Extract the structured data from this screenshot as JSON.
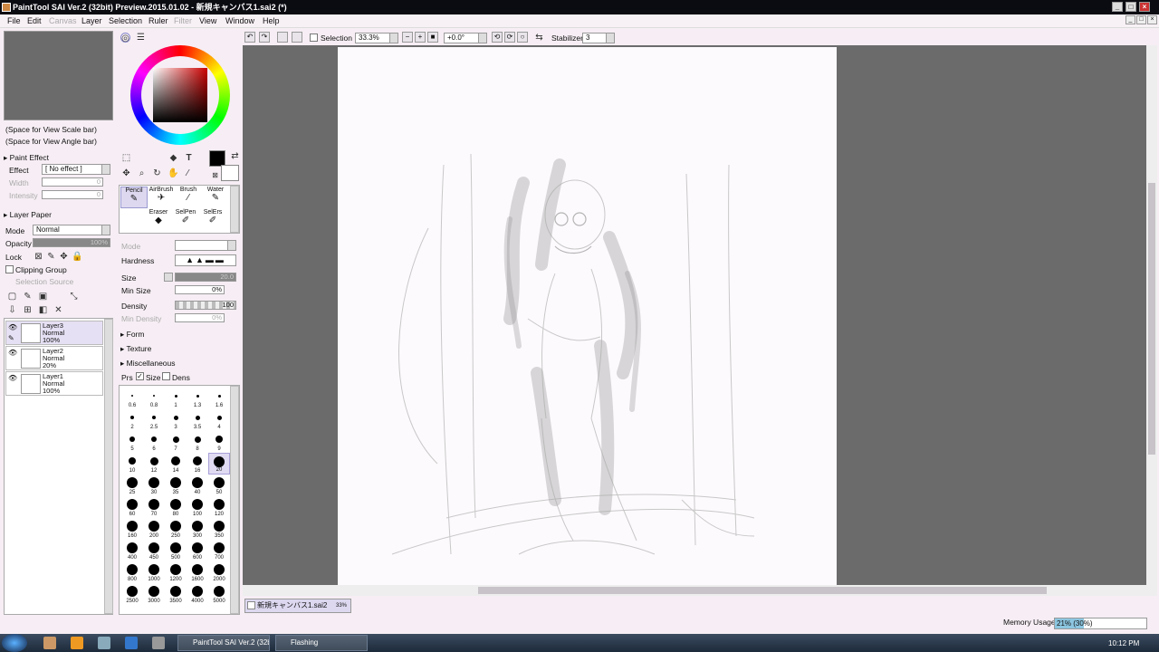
{
  "window": {
    "title": "PaintTool SAI Ver.2 (32bit) Preview.2015.01.02 - 新規キャンバス1.sai2 (*)"
  },
  "menu": [
    {
      "label": "File",
      "enabled": true
    },
    {
      "label": "Edit",
      "enabled": true
    },
    {
      "label": "Canvas",
      "enabled": false
    },
    {
      "label": "Layer",
      "enabled": true
    },
    {
      "label": "Selection",
      "enabled": true
    },
    {
      "label": "Ruler",
      "enabled": true
    },
    {
      "label": "Filter",
      "enabled": false
    },
    {
      "label": "View",
      "enabled": true
    },
    {
      "label": "Window",
      "enabled": true
    },
    {
      "label": "Help",
      "enabled": true
    }
  ],
  "toolbar": {
    "selection_label": "Selection",
    "zoom": "33.3%",
    "angle": "+0.0°",
    "stabilizer_label": "Stabilizer",
    "stabilizer_value": "3"
  },
  "left": {
    "view_scale": "(Space for View Scale bar)",
    "view_angle": "(Space for View Angle bar)",
    "paint_effect_label": "Paint Effect",
    "effect_label": "Effect",
    "effect_value": "[ No effect ]",
    "width_label": "Width",
    "width_value": "0",
    "intensity_label": "Intensity",
    "intensity_value": "0",
    "layer_paper_label": "Layer Paper",
    "mode_label": "Mode",
    "mode_value": "Normal",
    "opacity_label": "Opacity",
    "opacity_value": "100%",
    "lock_label": "Lock",
    "clipping_label": "Clipping Group",
    "selection_source_label": "Selection Source"
  },
  "layers": [
    {
      "name": "Layer3",
      "mode": "Normal",
      "opacity": "100%",
      "active": true
    },
    {
      "name": "Layer2",
      "mode": "Normal",
      "opacity": "20%",
      "active": false
    },
    {
      "name": "Layer1",
      "mode": "Normal",
      "opacity": "100%",
      "active": false
    }
  ],
  "tools": {
    "brushes": [
      {
        "label": "Pencil",
        "active": true
      },
      {
        "label": "AirBrush",
        "active": false
      },
      {
        "label": "Brush",
        "active": false
      },
      {
        "label": "Water",
        "active": false
      },
      {
        "label": "Eraser",
        "active": false
      },
      {
        "label": "SelPen",
        "active": false
      },
      {
        "label": "SelErs",
        "active": false
      }
    ],
    "mode_label": "Mode",
    "hardness_label": "Hardness",
    "size_label": "Size",
    "size_value": "20.0",
    "min_size_label": "Min Size",
    "min_size_value": "0%",
    "density_label": "Density",
    "density_value": "100",
    "min_density_label": "Min Density",
    "min_density_value": "0%",
    "form_label": "Form",
    "texture_label": "Texture",
    "misc_label": "Miscellaneous",
    "prs_label": "Prs",
    "size_chk_label": "Size",
    "dens_chk_label": "Dens"
  },
  "brush_sizes": [
    "0.6",
    "0.8",
    "1",
    "1.3",
    "1.6",
    "2",
    "2.5",
    "3",
    "3.5",
    "4",
    "5",
    "6",
    "7",
    "8",
    "9",
    "10",
    "12",
    "14",
    "16",
    "20",
    "25",
    "30",
    "35",
    "40",
    "50",
    "60",
    "70",
    "80",
    "100",
    "120",
    "160",
    "200",
    "250",
    "300",
    "350",
    "400",
    "450",
    "500",
    "600",
    "700",
    "800",
    "1000",
    "1200",
    "1600",
    "2000",
    "2500",
    "3000",
    "3500",
    "4000",
    "5000"
  ],
  "active_brush_size": "20",
  "canvas_tab": {
    "name": "新規キャンバス1.sai2",
    "zoom": "33%"
  },
  "status": {
    "memory_label": "Memory Usage",
    "memory_value": "21% (30%)",
    "memory_fill": 0.32
  },
  "taskbar": {
    "tasks": [
      "PaintTool SAI Ver.2 (32bit)...",
      "Flashing"
    ],
    "clock": "10:12 PM"
  }
}
